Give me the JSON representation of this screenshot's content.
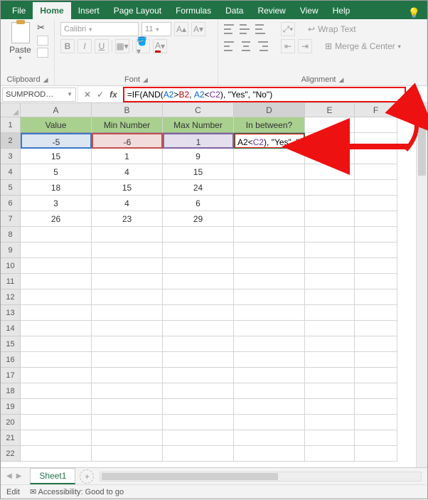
{
  "tabs": {
    "file": "File",
    "home": "Home",
    "insert": "Insert",
    "pagelayout": "Page Layout",
    "formulas": "Formulas",
    "data": "Data",
    "review": "Review",
    "view": "View",
    "help": "Help"
  },
  "ribbon": {
    "clipboard": {
      "paste": "Paste",
      "label": "Clipboard"
    },
    "font": {
      "name": "Calibri",
      "size": "11",
      "label": "Font",
      "bold": "B",
      "italic": "I",
      "underline": "U"
    },
    "alignment": {
      "label": "Alignment",
      "wrap": "Wrap Text",
      "merge": "Merge & Center"
    }
  },
  "formula_bar": {
    "namebox": "SUMPROD…",
    "fx": "fx",
    "formula_parts": {
      "p1": "=IF(AND(",
      "a2_1": "A2",
      "gt": ">",
      "b2": "B2",
      "comma1": ", ",
      "a2_2": "A2",
      "lt": "<",
      "c2": "C2",
      "p2": "), \"Yes\", \"No\")"
    }
  },
  "columns": {
    "A": "A",
    "B": "B",
    "C": "C",
    "D": "D",
    "E": "E",
    "F": "F"
  },
  "headers": {
    "A": "Value",
    "B": "Min Number",
    "C": "Max Number",
    "D": "In between?"
  },
  "editing_cell_parts": {
    "a2": "A2",
    "lt": "<",
    "c2": "C2",
    "tail": "), \"Yes\", \"No\")"
  },
  "rows": [
    {
      "n": "1"
    },
    {
      "n": "2",
      "A": "-5",
      "B": "-6",
      "C": "1"
    },
    {
      "n": "3",
      "A": "15",
      "B": "1",
      "C": "9"
    },
    {
      "n": "4",
      "A": "5",
      "B": "4",
      "C": "15"
    },
    {
      "n": "5",
      "A": "18",
      "B": "15",
      "C": "24"
    },
    {
      "n": "6",
      "A": "3",
      "B": "4",
      "C": "6"
    },
    {
      "n": "7",
      "A": "26",
      "B": "23",
      "C": "29"
    },
    {
      "n": "8"
    },
    {
      "n": "9"
    },
    {
      "n": "10"
    },
    {
      "n": "11"
    },
    {
      "n": "12"
    },
    {
      "n": "13"
    },
    {
      "n": "14"
    },
    {
      "n": "15"
    },
    {
      "n": "16"
    },
    {
      "n": "17"
    },
    {
      "n": "18"
    },
    {
      "n": "19"
    },
    {
      "n": "20"
    },
    {
      "n": "21"
    },
    {
      "n": "22"
    }
  ],
  "sheet": {
    "name": "Sheet1"
  },
  "status": {
    "mode": "Edit",
    "acc": "Accessibility: Good to go"
  }
}
